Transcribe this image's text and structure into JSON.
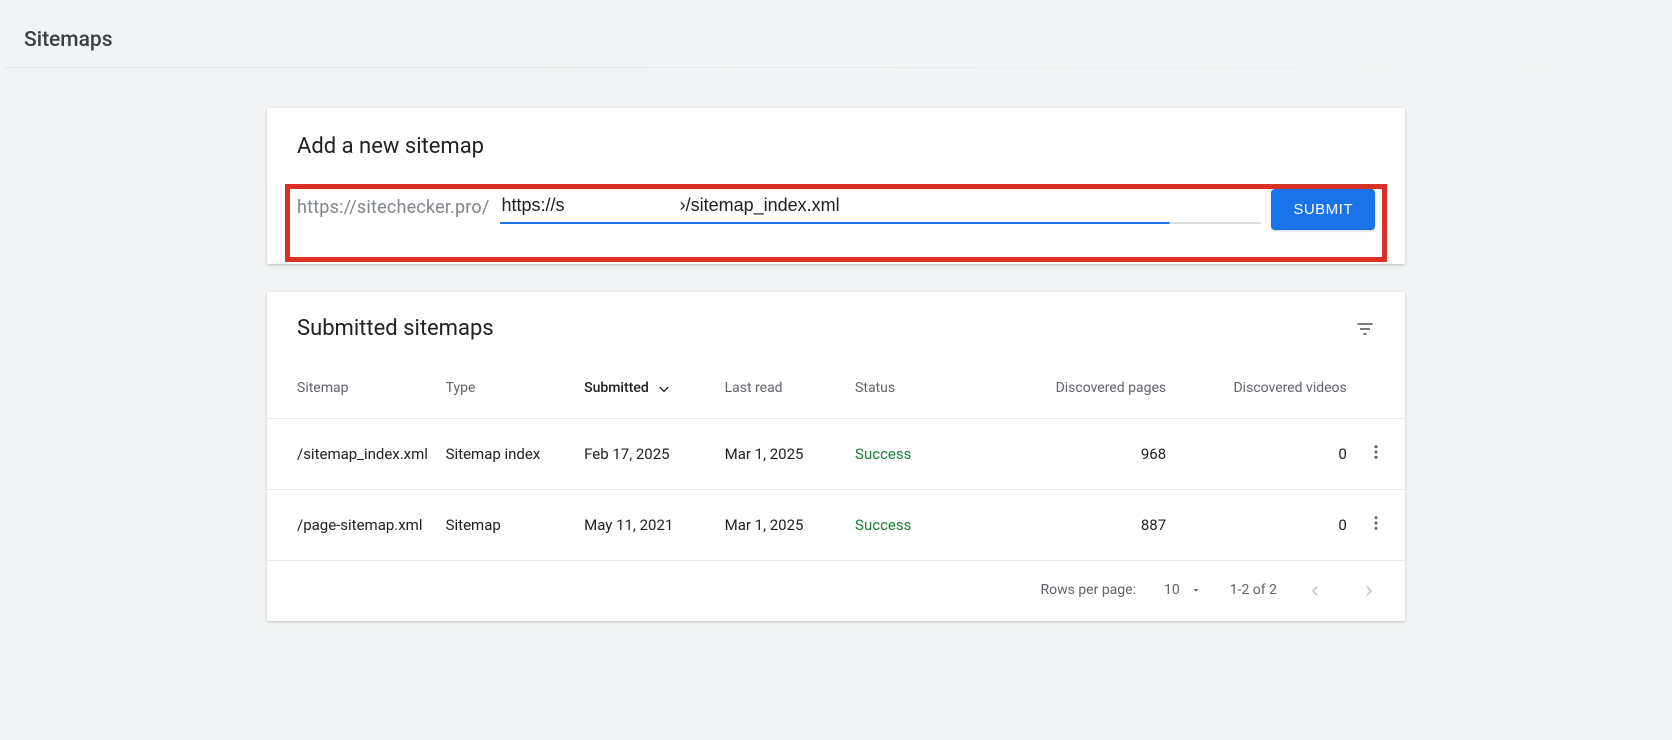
{
  "page": {
    "title": "Sitemaps"
  },
  "add_card": {
    "title": "Add a new sitemap",
    "domain_prefix": "https://sitechecker.pro/",
    "input_value": "https://s                       ›/sitemap_index.xml",
    "submit_label": "SUBMIT"
  },
  "submitted": {
    "title": "Submitted sitemaps",
    "columns": {
      "sitemap": "Sitemap",
      "type": "Type",
      "submitted": "Submitted",
      "last_read": "Last read",
      "status": "Status",
      "discovered_pages": "Discovered pages",
      "discovered_videos": "Discovered videos"
    },
    "rows": [
      {
        "sitemap": "/sitemap_index.xml",
        "type": "Sitemap index",
        "submitted": "Feb 17, 2025",
        "last_read": "Mar 1, 2025",
        "status": "Success",
        "discovered_pages": "968",
        "discovered_videos": "0"
      },
      {
        "sitemap": "/page-sitemap.xml",
        "type": "Sitemap",
        "submitted": "May 11, 2021",
        "last_read": "Mar 1, 2025",
        "status": "Success",
        "discovered_pages": "887",
        "discovered_videos": "0"
      }
    ]
  },
  "pagination": {
    "rows_per_page_label": "Rows per page:",
    "rows_per_page_value": "10",
    "range_label": "1-2 of 2"
  }
}
